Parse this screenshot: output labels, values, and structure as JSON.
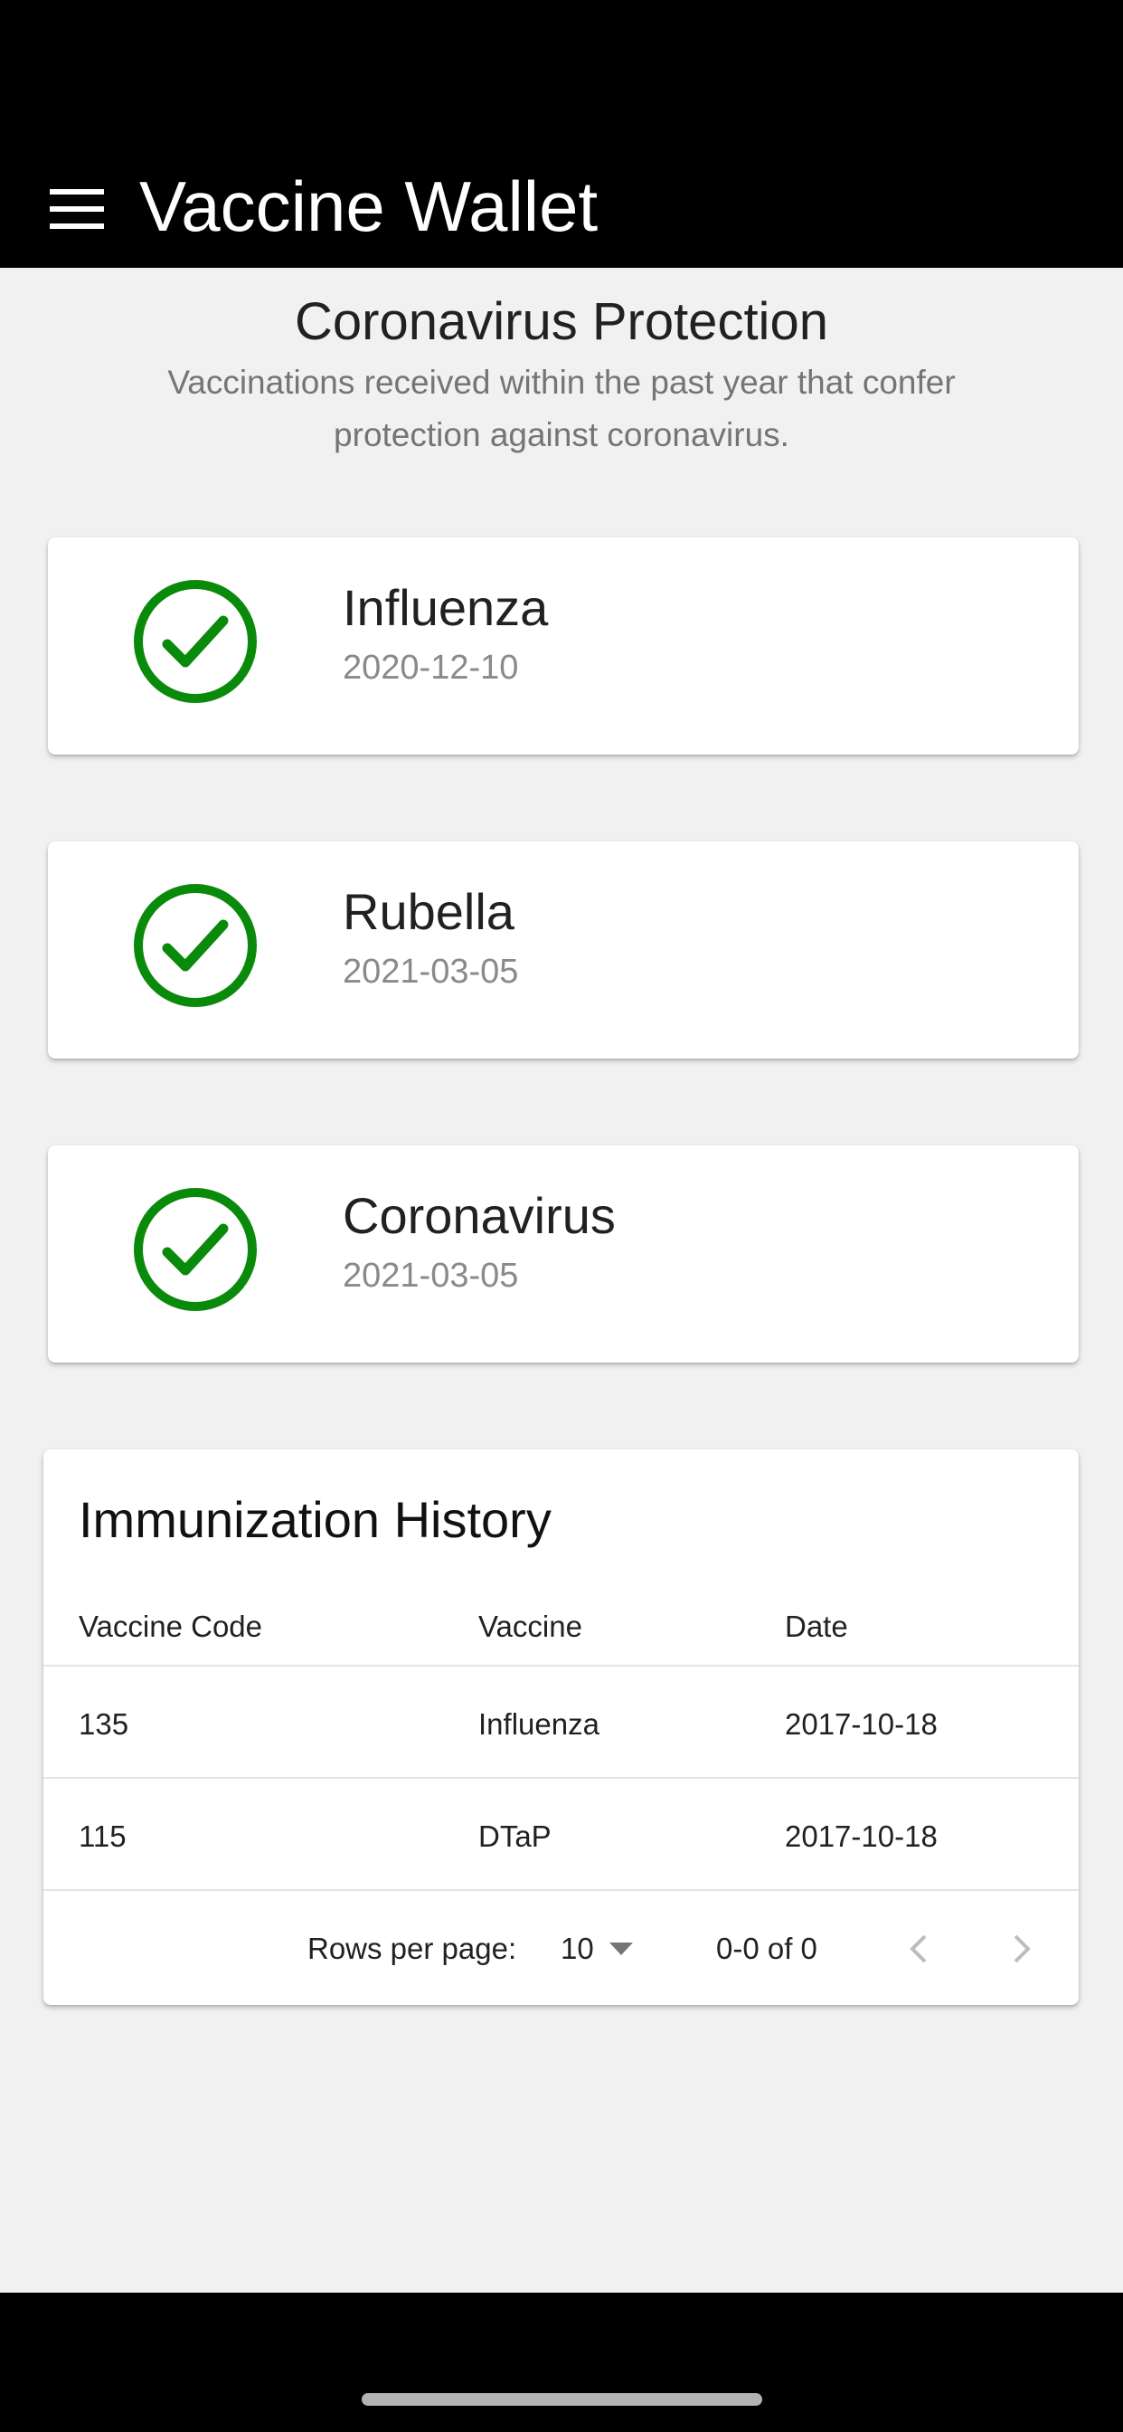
{
  "app": {
    "title": "Vaccine Wallet"
  },
  "protection": {
    "title": "Coronavirus Protection",
    "subtitle": "Vaccinations received within the past year that confer protection against coronavirus.",
    "cards": [
      {
        "name": "Influenza",
        "date": "2020-12-10",
        "icon": "check-circle-icon"
      },
      {
        "name": "Rubella",
        "date": "2021-03-05",
        "icon": "check-circle-icon"
      },
      {
        "name": "Coronavirus",
        "date": "2021-03-05",
        "icon": "check-circle-icon"
      }
    ]
  },
  "history": {
    "title": "Immunization History",
    "columns": [
      "Vaccine Code",
      "Vaccine",
      "Date"
    ],
    "rows": [
      [
        "135",
        "Influenza",
        "2017-10-18"
      ],
      [
        "115",
        "DTaP",
        "2017-10-18"
      ]
    ],
    "pagination": {
      "rows_per_page_label": "Rows per page:",
      "rows_per_page_value": "10",
      "range": "0-0 of 0"
    }
  },
  "colors": {
    "check": "#0a8a0a",
    "header_bg": "#000000",
    "page_bg": "#f1f1f1"
  }
}
